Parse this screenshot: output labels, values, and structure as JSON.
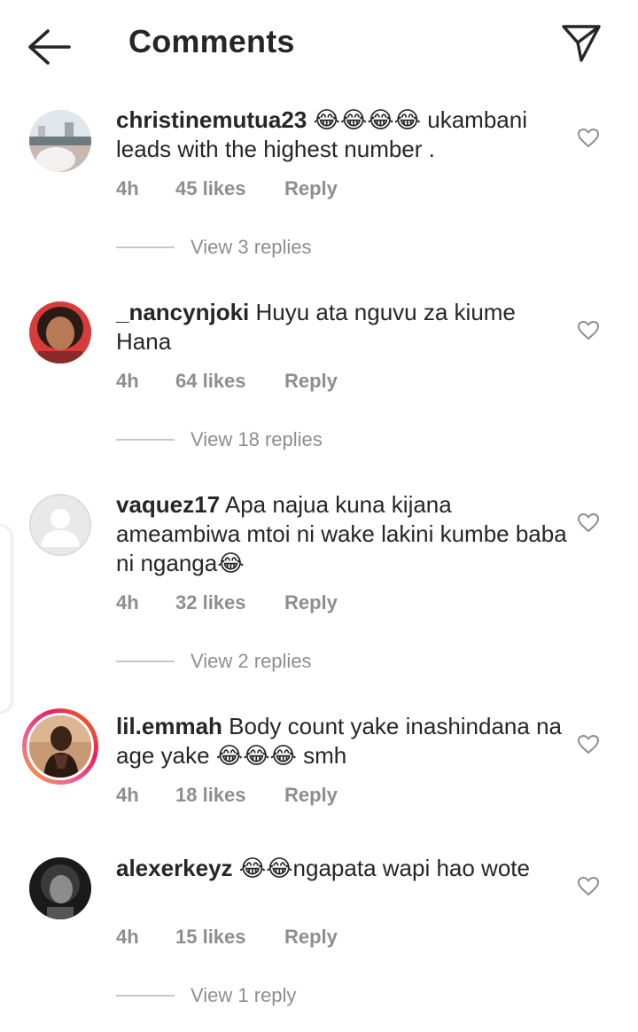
{
  "header": {
    "title": "Comments"
  },
  "comments": [
    {
      "username": "christinemutua23",
      "text": " 😂😂😂😂 ukambani leads with the highest number .",
      "time": "4h",
      "likes": "45 likes",
      "reply": "Reply",
      "view_replies": "View 3 replies"
    },
    {
      "username": "_nancynjoki",
      "text": " Huyu ata  nguvu za kiume Hana",
      "time": "4h",
      "likes": "64 likes",
      "reply": "Reply",
      "view_replies": "View 18 replies"
    },
    {
      "username": "vaquez17",
      "text": " Apa najua kuna kijana ameambiwa mtoi ni wake lakini kumbe baba ni nganga😂",
      "time": "4h",
      "likes": "32 likes",
      "reply": "Reply",
      "view_replies": "View 2 replies"
    },
    {
      "username": "lil.emmah",
      "text": " Body count yake inashindana na age yake 😂😂😂 smh",
      "time": "4h",
      "likes": "18 likes",
      "reply": "Reply",
      "view_replies": ""
    },
    {
      "username": "alexerkeyz",
      "text": " 😂😂ngapata wapi hao wote",
      "time": "4h",
      "likes": "15 likes",
      "reply": "Reply",
      "view_replies": "View 1 reply"
    }
  ],
  "icons": {
    "back": "arrow-left-icon",
    "send": "paper-plane-icon",
    "like": "heart-outline-icon"
  },
  "colors": {
    "text": "#262626",
    "muted": "#8e8e8e",
    "story_ring": "#e91e63"
  }
}
